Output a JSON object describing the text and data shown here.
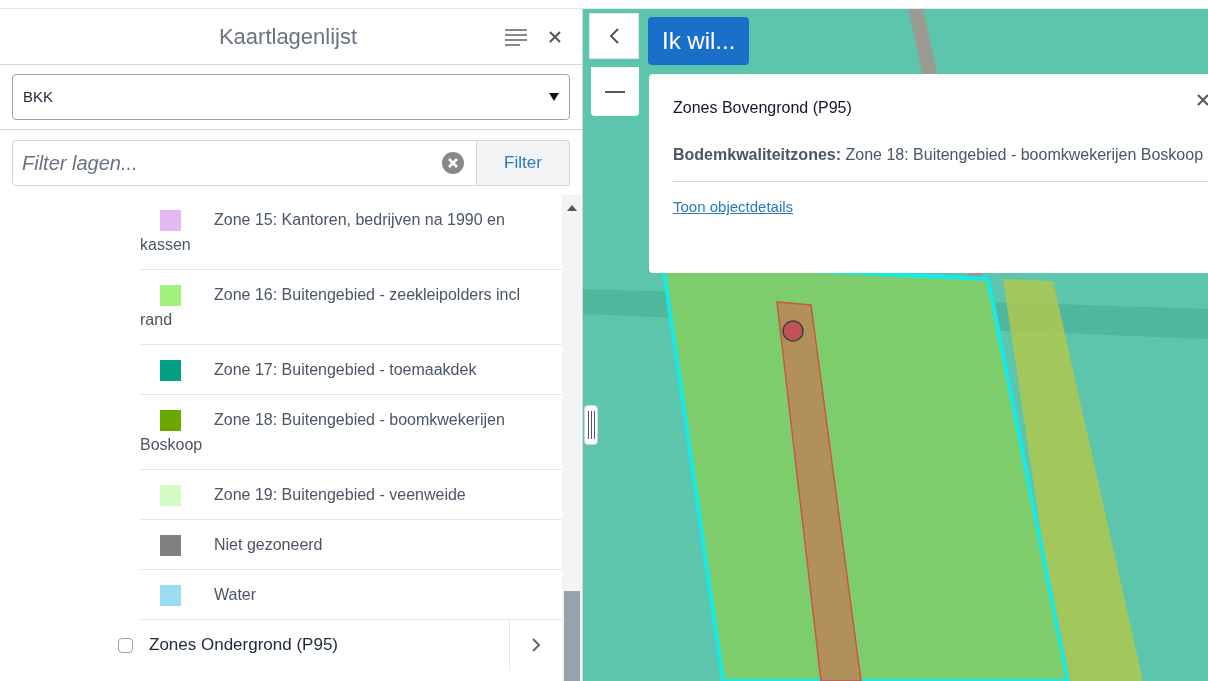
{
  "panel": {
    "title": "Kaartlagenlijst",
    "select": {
      "value": "BKK"
    },
    "filter": {
      "placeholder": "Filter lagen...",
      "button": "Filter"
    }
  },
  "legend": [
    {
      "label": "Zone 15: Kantoren, bedrijven na 1990 en kassen",
      "color": "#e5b8f3"
    },
    {
      "label": "Zone 16: Buitengebied - zeekleipolders incl rand",
      "color": "#a3f07a"
    },
    {
      "label": "Zone 17: Buitengebied - toemaakdek",
      "color": "#00a184"
    },
    {
      "label": "Zone 18: Buitengebied - boomkwekerijen Boskoop",
      "color": "#6aa800"
    },
    {
      "label": "Zone 19: Buitengebied - veenweide",
      "color": "#d3fcc4"
    },
    {
      "label": "Niet gezoneerd",
      "color": "#808080"
    },
    {
      "label": "Water",
      "color": "#9bdcf2"
    }
  ],
  "layer": {
    "label": "Zones Ondergrond (P95)",
    "checked": false
  },
  "map": {
    "action_button": "Ik wil...",
    "popup": {
      "title": "Zones Bovengrond (P95)",
      "body": "**Bodemkwaliteitzones:** Zone 18: Buitengebied - boomkwekerijen Boskoop",
      "link": "Toon objectdetails"
    }
  }
}
